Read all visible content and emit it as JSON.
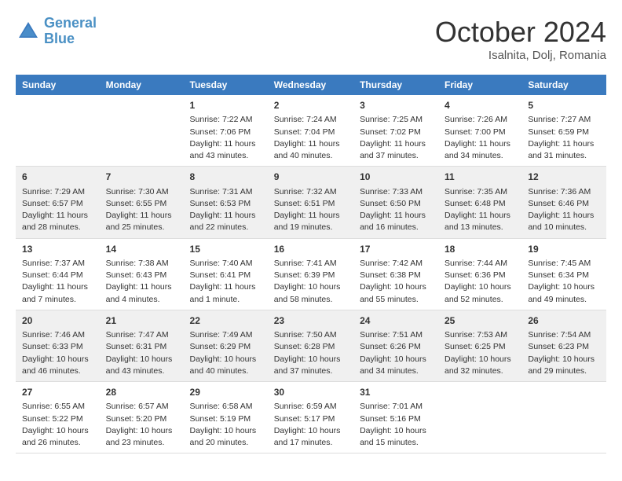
{
  "header": {
    "logo_line1": "General",
    "logo_line2": "Blue",
    "month": "October 2024",
    "location": "Isalnita, Dolj, Romania"
  },
  "weekdays": [
    "Sunday",
    "Monday",
    "Tuesday",
    "Wednesday",
    "Thursday",
    "Friday",
    "Saturday"
  ],
  "weeks": [
    [
      {
        "day": "",
        "info": ""
      },
      {
        "day": "",
        "info": ""
      },
      {
        "day": "1",
        "info": "Sunrise: 7:22 AM\nSunset: 7:06 PM\nDaylight: 11 hours and 43 minutes."
      },
      {
        "day": "2",
        "info": "Sunrise: 7:24 AM\nSunset: 7:04 PM\nDaylight: 11 hours and 40 minutes."
      },
      {
        "day": "3",
        "info": "Sunrise: 7:25 AM\nSunset: 7:02 PM\nDaylight: 11 hours and 37 minutes."
      },
      {
        "day": "4",
        "info": "Sunrise: 7:26 AM\nSunset: 7:00 PM\nDaylight: 11 hours and 34 minutes."
      },
      {
        "day": "5",
        "info": "Sunrise: 7:27 AM\nSunset: 6:59 PM\nDaylight: 11 hours and 31 minutes."
      }
    ],
    [
      {
        "day": "6",
        "info": "Sunrise: 7:29 AM\nSunset: 6:57 PM\nDaylight: 11 hours and 28 minutes."
      },
      {
        "day": "7",
        "info": "Sunrise: 7:30 AM\nSunset: 6:55 PM\nDaylight: 11 hours and 25 minutes."
      },
      {
        "day": "8",
        "info": "Sunrise: 7:31 AM\nSunset: 6:53 PM\nDaylight: 11 hours and 22 minutes."
      },
      {
        "day": "9",
        "info": "Sunrise: 7:32 AM\nSunset: 6:51 PM\nDaylight: 11 hours and 19 minutes."
      },
      {
        "day": "10",
        "info": "Sunrise: 7:33 AM\nSunset: 6:50 PM\nDaylight: 11 hours and 16 minutes."
      },
      {
        "day": "11",
        "info": "Sunrise: 7:35 AM\nSunset: 6:48 PM\nDaylight: 11 hours and 13 minutes."
      },
      {
        "day": "12",
        "info": "Sunrise: 7:36 AM\nSunset: 6:46 PM\nDaylight: 11 hours and 10 minutes."
      }
    ],
    [
      {
        "day": "13",
        "info": "Sunrise: 7:37 AM\nSunset: 6:44 PM\nDaylight: 11 hours and 7 minutes."
      },
      {
        "day": "14",
        "info": "Sunrise: 7:38 AM\nSunset: 6:43 PM\nDaylight: 11 hours and 4 minutes."
      },
      {
        "day": "15",
        "info": "Sunrise: 7:40 AM\nSunset: 6:41 PM\nDaylight: 11 hours and 1 minute."
      },
      {
        "day": "16",
        "info": "Sunrise: 7:41 AM\nSunset: 6:39 PM\nDaylight: 10 hours and 58 minutes."
      },
      {
        "day": "17",
        "info": "Sunrise: 7:42 AM\nSunset: 6:38 PM\nDaylight: 10 hours and 55 minutes."
      },
      {
        "day": "18",
        "info": "Sunrise: 7:44 AM\nSunset: 6:36 PM\nDaylight: 10 hours and 52 minutes."
      },
      {
        "day": "19",
        "info": "Sunrise: 7:45 AM\nSunset: 6:34 PM\nDaylight: 10 hours and 49 minutes."
      }
    ],
    [
      {
        "day": "20",
        "info": "Sunrise: 7:46 AM\nSunset: 6:33 PM\nDaylight: 10 hours and 46 minutes."
      },
      {
        "day": "21",
        "info": "Sunrise: 7:47 AM\nSunset: 6:31 PM\nDaylight: 10 hours and 43 minutes."
      },
      {
        "day": "22",
        "info": "Sunrise: 7:49 AM\nSunset: 6:29 PM\nDaylight: 10 hours and 40 minutes."
      },
      {
        "day": "23",
        "info": "Sunrise: 7:50 AM\nSunset: 6:28 PM\nDaylight: 10 hours and 37 minutes."
      },
      {
        "day": "24",
        "info": "Sunrise: 7:51 AM\nSunset: 6:26 PM\nDaylight: 10 hours and 34 minutes."
      },
      {
        "day": "25",
        "info": "Sunrise: 7:53 AM\nSunset: 6:25 PM\nDaylight: 10 hours and 32 minutes."
      },
      {
        "day": "26",
        "info": "Sunrise: 7:54 AM\nSunset: 6:23 PM\nDaylight: 10 hours and 29 minutes."
      }
    ],
    [
      {
        "day": "27",
        "info": "Sunrise: 6:55 AM\nSunset: 5:22 PM\nDaylight: 10 hours and 26 minutes."
      },
      {
        "day": "28",
        "info": "Sunrise: 6:57 AM\nSunset: 5:20 PM\nDaylight: 10 hours and 23 minutes."
      },
      {
        "day": "29",
        "info": "Sunrise: 6:58 AM\nSunset: 5:19 PM\nDaylight: 10 hours and 20 minutes."
      },
      {
        "day": "30",
        "info": "Sunrise: 6:59 AM\nSunset: 5:17 PM\nDaylight: 10 hours and 17 minutes."
      },
      {
        "day": "31",
        "info": "Sunrise: 7:01 AM\nSunset: 5:16 PM\nDaylight: 10 hours and 15 minutes."
      },
      {
        "day": "",
        "info": ""
      },
      {
        "day": "",
        "info": ""
      }
    ]
  ]
}
